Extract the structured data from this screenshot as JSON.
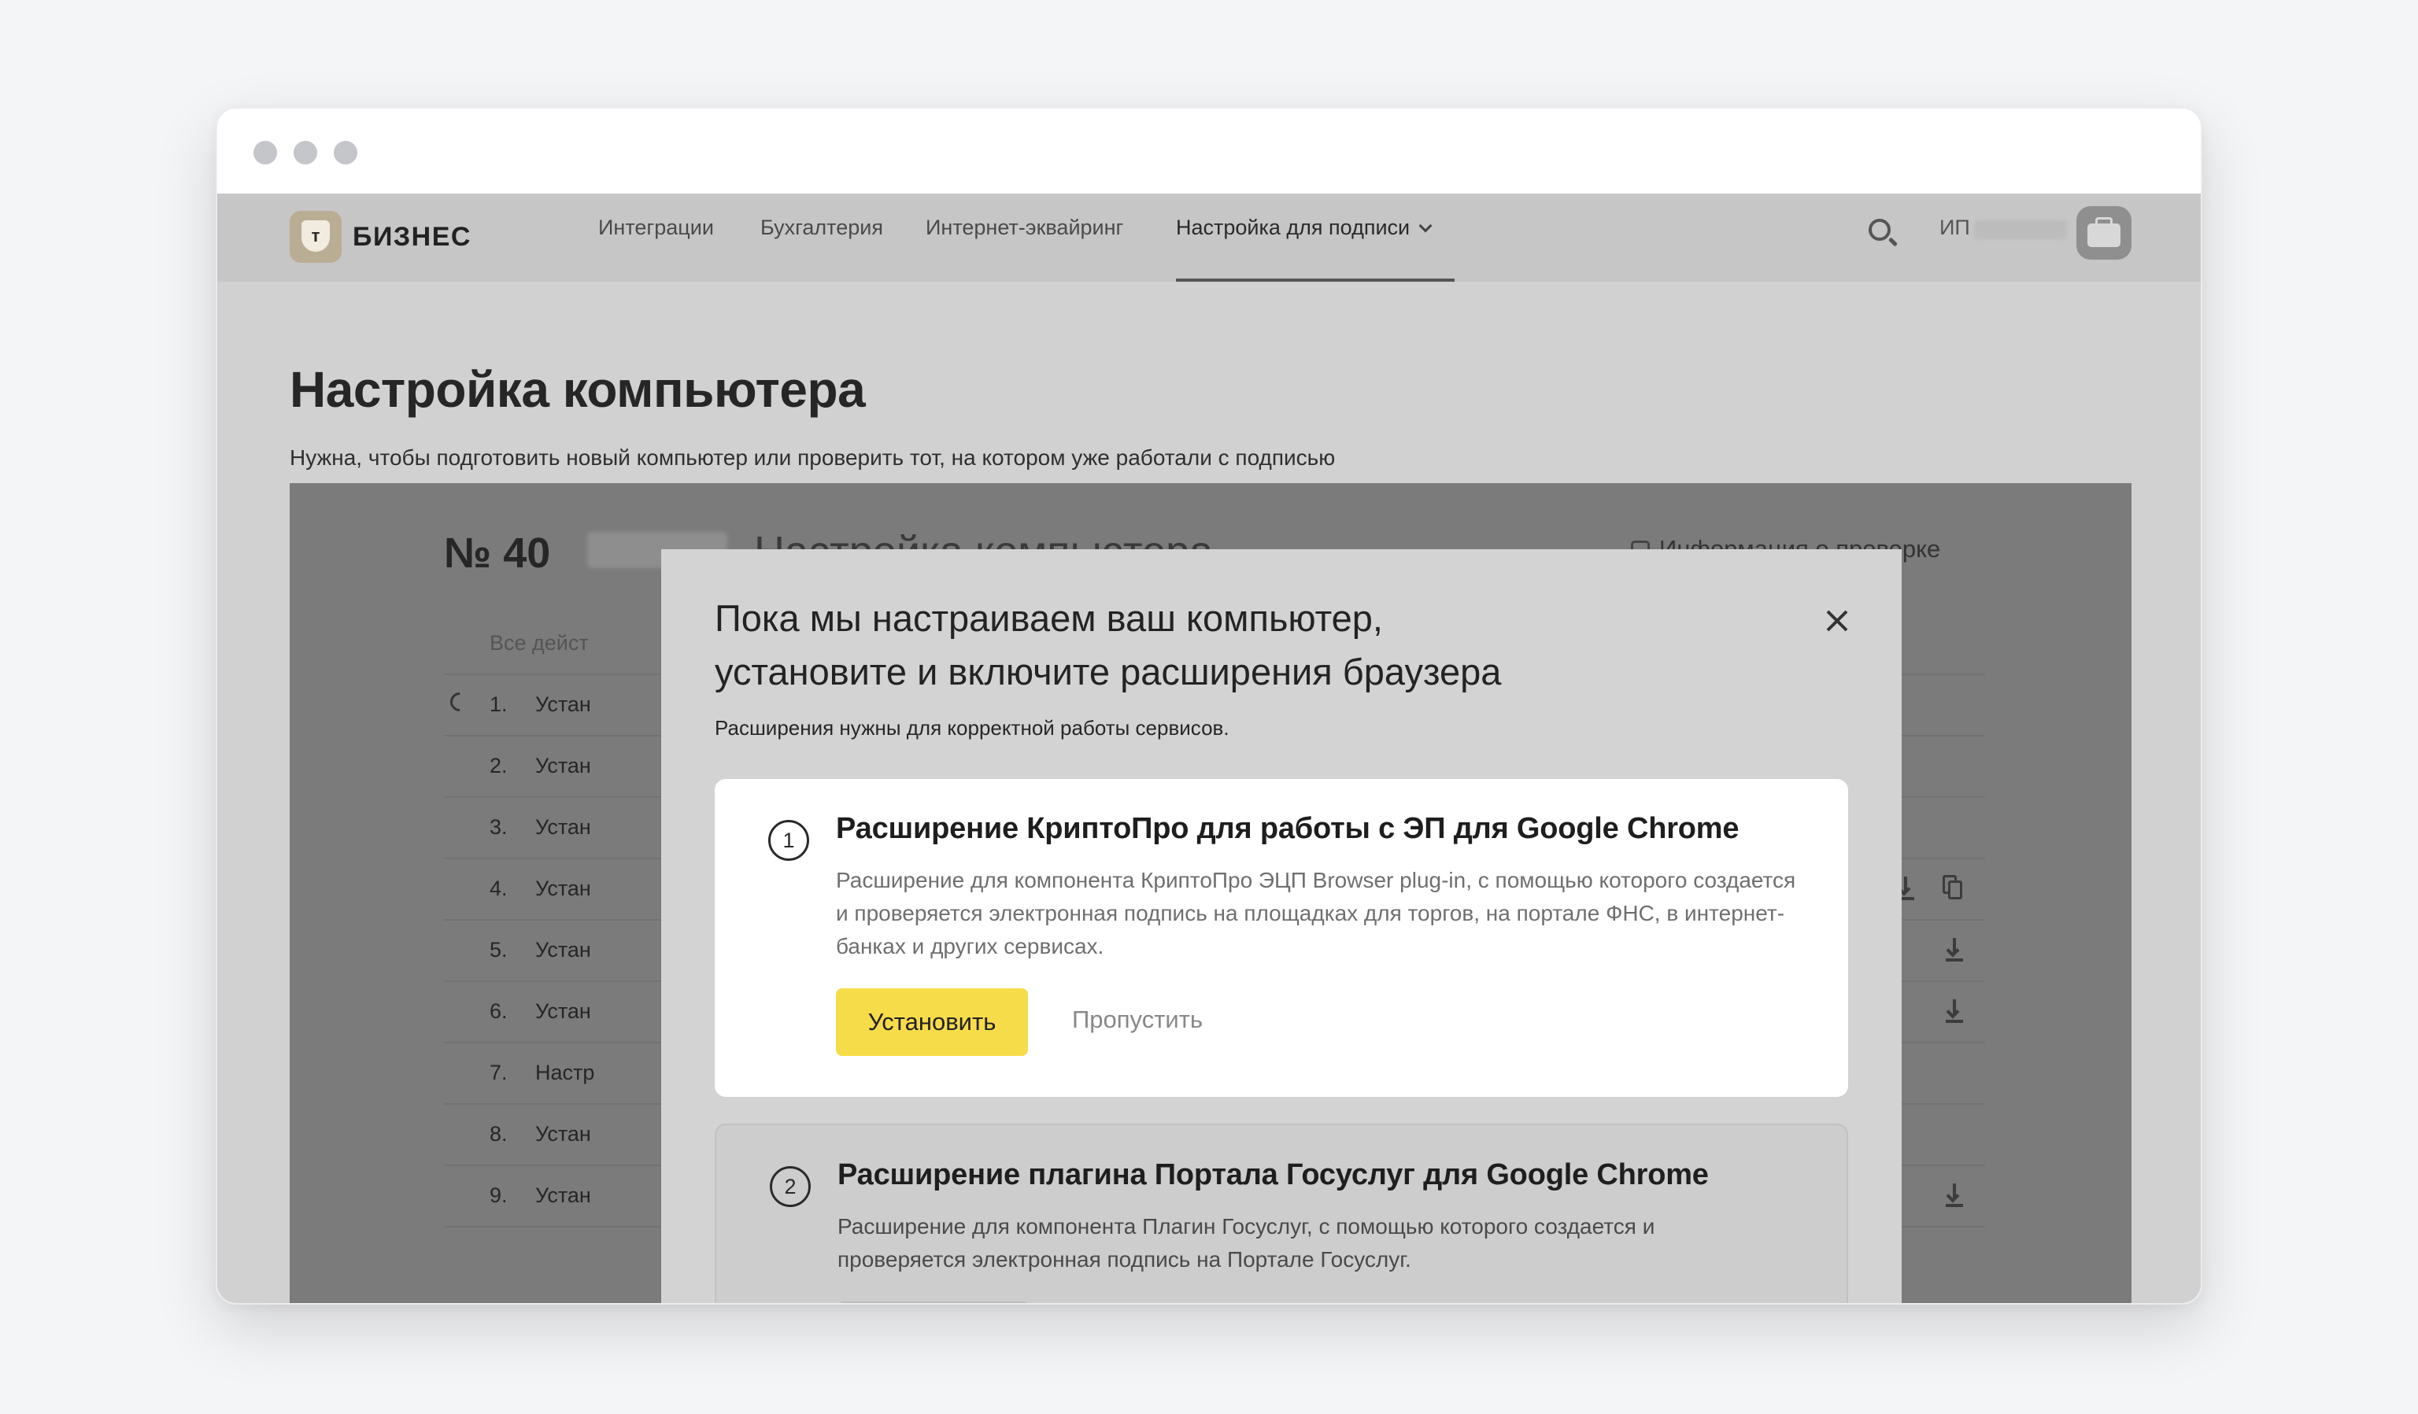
{
  "nav": {
    "logo_text": "БИЗНЕС",
    "logo_letter": "т",
    "items": [
      {
        "label": "Интеграции"
      },
      {
        "label": "Бухгалтерия"
      },
      {
        "label": "Интернет-эквайринг"
      },
      {
        "label": "Настройка для подписи"
      }
    ],
    "account_prefix": "ИП"
  },
  "page": {
    "title": "Настройка компьютера",
    "subtitle": "Нужна, чтобы подготовить новый компьютер или проверить тот, на котором уже работали с подписью"
  },
  "background": {
    "number": "№ 40",
    "heading": "Настройка компьютера",
    "info_link": "Информация о проверке",
    "all_actions": "Все дейст",
    "rows": [
      {
        "num": "1.",
        "text": "Устан"
      },
      {
        "num": "2.",
        "text": "Устан"
      },
      {
        "num": "3.",
        "text": "Устан"
      },
      {
        "num": "4.",
        "text": "Устан"
      },
      {
        "num": "5.",
        "text": "Устан"
      },
      {
        "num": "6.",
        "text": "Устан"
      },
      {
        "num": "7.",
        "text": "Настр"
      },
      {
        "num": "8.",
        "text": "Устан"
      },
      {
        "num": "9.",
        "text": "Устан"
      }
    ]
  },
  "modal": {
    "title_line1": "Пока мы настраиваем ваш компьютер,",
    "title_line2": "установите и включите расширения браузера",
    "description": "Расширения нужны для корректной работы сервисов.",
    "steps": [
      {
        "number": "1",
        "title": "Расширение КриптоПро для работы с ЭП для Google Chrome",
        "text": "Расширение для компонента КриптоПро ЭЦП Browser plug-in, с помощью которого создается и проверяется электронная подпись на площадках для торгов, на портале ФНС, в интернет-банках и других сервисах.",
        "install_label": "Установить",
        "skip_label": "Пропустить"
      },
      {
        "number": "2",
        "title": "Расширение плагина Портала Госуслуг для Google Chrome",
        "text": "Расширение для компонента Плагин Госуслуг, с помощью которого создается и проверяется электронная подпись на Портале Госуслуг."
      }
    ]
  },
  "colors": {
    "accent": "#f7dc4a",
    "overlay": "#7b7b7b"
  }
}
